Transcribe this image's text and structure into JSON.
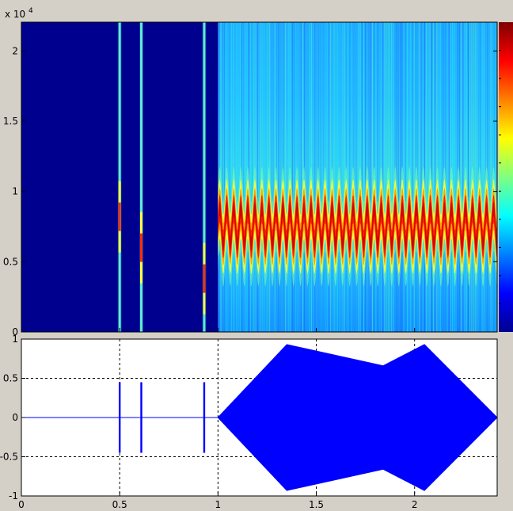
{
  "chart_data": [
    {
      "type": "heatmap",
      "title": "",
      "xlabel": "",
      "ylabel": "",
      "xlim": [
        0,
        2.42
      ],
      "ylim": [
        0,
        22050
      ],
      "y_tick_labels": [
        "0",
        "0.5",
        "1",
        "1.5",
        "2"
      ],
      "y_tick_values": [
        0,
        5000,
        10000,
        15000,
        20000
      ],
      "y_exponent_label": "x 10",
      "y_exponent_power": "4",
      "colormap": "jet",
      "colorbar": true,
      "grid": false,
      "bursts": [
        {
          "t": 0.5,
          "peak_freq": 8200
        },
        {
          "t": 0.61,
          "peak_freq": 6000
        },
        {
          "t": 0.93,
          "peak_freq": 3800
        }
      ],
      "sweep": {
        "t_start": 1.0,
        "t_end": 2.42,
        "center_freq": 7500,
        "freq_swing": 1300
      }
    },
    {
      "type": "line",
      "title": "",
      "xlabel": "",
      "ylabel": "",
      "xlim": [
        0,
        2.42
      ],
      "ylim": [
        -1,
        1
      ],
      "x_tick_labels": [
        "0",
        "0.5",
        "1",
        "1.5",
        "2"
      ],
      "x_tick_values": [
        0,
        0.5,
        1,
        1.5,
        2
      ],
      "y_tick_labels": [
        "-1",
        "-0.5",
        "0",
        "0.5",
        "1"
      ],
      "y_tick_values": [
        -1,
        -0.5,
        0,
        0.5,
        1
      ],
      "grid": true,
      "line_color": "#0000ff",
      "bursts": [
        {
          "t": 0.5,
          "amplitude": 0.45
        },
        {
          "t": 0.61,
          "amplitude": 0.45
        },
        {
          "t": 0.93,
          "amplitude": 0.45
        }
      ],
      "envelope": {
        "t": [
          1.0,
          1.35,
          1.84,
          2.05,
          2.42
        ],
        "upper": [
          0.0,
          0.93,
          0.66,
          0.93,
          0.0
        ],
        "lower": [
          0.0,
          -0.93,
          -0.66,
          -0.93,
          0.0
        ]
      }
    }
  ]
}
